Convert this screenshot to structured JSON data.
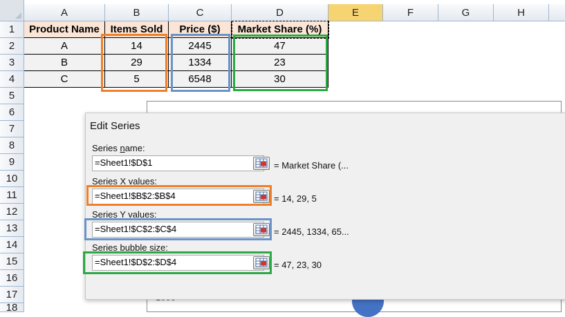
{
  "columns": [
    "A",
    "B",
    "C",
    "D",
    "E",
    "F",
    "G",
    "H"
  ],
  "rows": [
    "1",
    "2",
    "3",
    "4",
    "5",
    "6",
    "7",
    "8",
    "9",
    "10",
    "11",
    "12",
    "13",
    "14",
    "15",
    "16",
    "17",
    "18"
  ],
  "table": {
    "headers": [
      "Product Name",
      "Items Sold",
      "Price ($)",
      "Market Share (%)"
    ],
    "body": [
      [
        "A",
        "14",
        "2445",
        "47"
      ],
      [
        "B",
        "29",
        "1334",
        "23"
      ],
      [
        "C",
        "5",
        "6548",
        "30"
      ]
    ]
  },
  "chart": {
    "tick_label": "1000"
  },
  "dialog": {
    "title": "Edit Series",
    "series_name": {
      "label_pre": "Series ",
      "label_key": "n",
      "label_post": "ame:",
      "value": "=Sheet1!$D$1",
      "preview": "= Market Share (..."
    },
    "series_x": {
      "label_pre": "Series ",
      "label_key": "X",
      "label_post": " values:",
      "value": "=Sheet1!$B$2:$B$4",
      "preview": "= 14, 29, 5"
    },
    "series_y": {
      "label_pre": "Series ",
      "label_key": "Y",
      "label_post": " values:",
      "value": "=Sheet1!$C$2:$C$4",
      "preview": "= 2445, 1334, 65..."
    },
    "series_size": {
      "label_pre": "Series bubble si",
      "label_key": "z",
      "label_post": "e:",
      "value": "=Sheet1!$D$2:$D$4",
      "preview": "= 47, 23, 30"
    }
  },
  "colors": {
    "orange": "#f07f2a",
    "blue": "#6b93c7",
    "green": "#2ca844",
    "header_fill": "#fbe5d6",
    "body_fill": "#f2f2f2",
    "selected_column": "#f7d472"
  }
}
